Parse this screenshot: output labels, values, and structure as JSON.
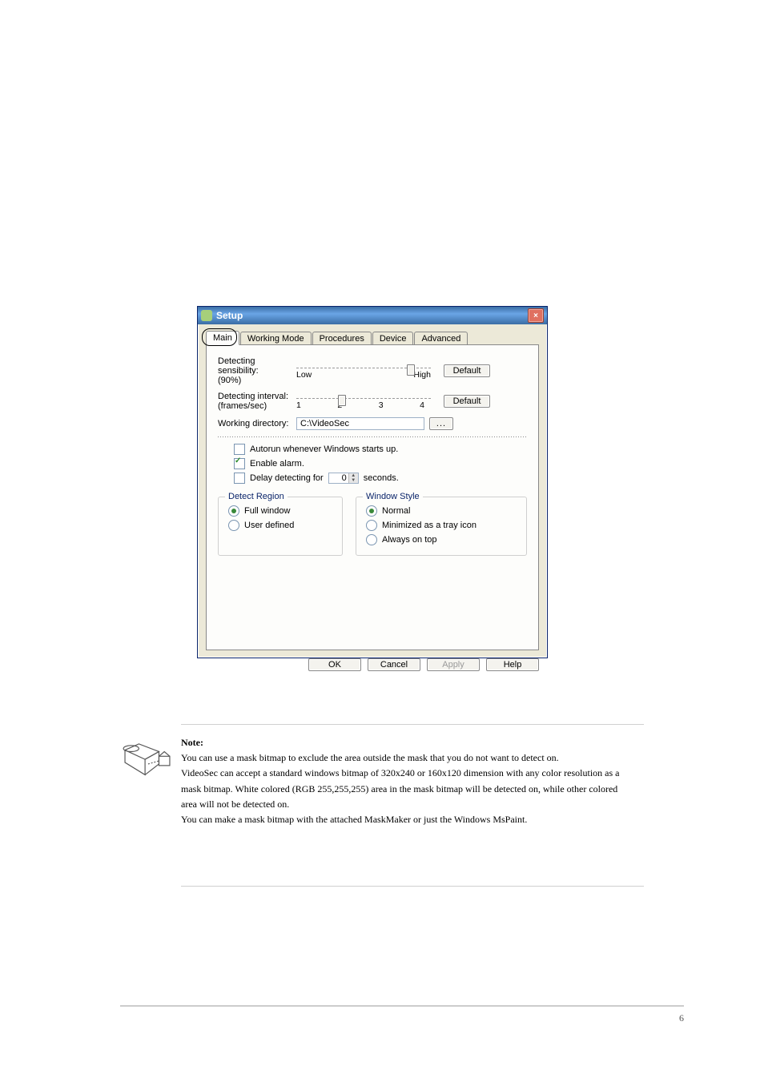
{
  "dialog": {
    "title": "Setup",
    "tabs": [
      "Main",
      "Working Mode",
      "Procedures",
      "Device",
      "Advanced"
    ],
    "active_tab": "Main",
    "sensibility": {
      "label": "Detecting sensibility:",
      "value_text": "(90%)",
      "low": "Low",
      "high": "High",
      "default_btn": "Default"
    },
    "interval": {
      "label": "Detecting interval:",
      "unit_text": "(frames/sec)",
      "ticks": [
        "1",
        "2",
        "3",
        "4"
      ],
      "default_btn": "Default"
    },
    "working_dir": {
      "label": "Working directory:",
      "value": "C:\\VideoSec",
      "browse": "..."
    },
    "opts": {
      "autorun": "Autorun whenever Windows starts up.",
      "enable_alarm": "Enable alarm.",
      "delay_label_pre": "Delay detecting for",
      "delay_value": "0",
      "delay_label_post": "seconds."
    },
    "detect_region": {
      "legend": "Detect Region",
      "full": "Full window",
      "user": "User defined"
    },
    "window_style": {
      "legend": "Window Style",
      "normal": "Normal",
      "tray": "Minimized as a tray icon",
      "top": "Always on top"
    },
    "buttons": {
      "ok": "OK",
      "cancel": "Cancel",
      "apply": "Apply",
      "help": "Help"
    }
  },
  "note": {
    "title": "Note:",
    "lines": [
      "You can use a mask bitmap to exclude the area outside the mask that you do not want to detect on.",
      "VideoSec can accept a standard windows bitmap of 320x240 or 160x120 dimension with any color resolution as a mask bitmap. White colored (RGB 255,255,255) area in the mask bitmap will be detected on, while other colored area will not be detected on.",
      "You can make a mask bitmap with the attached MaskMaker or just the Windows MsPaint."
    ]
  },
  "page_number": "6"
}
